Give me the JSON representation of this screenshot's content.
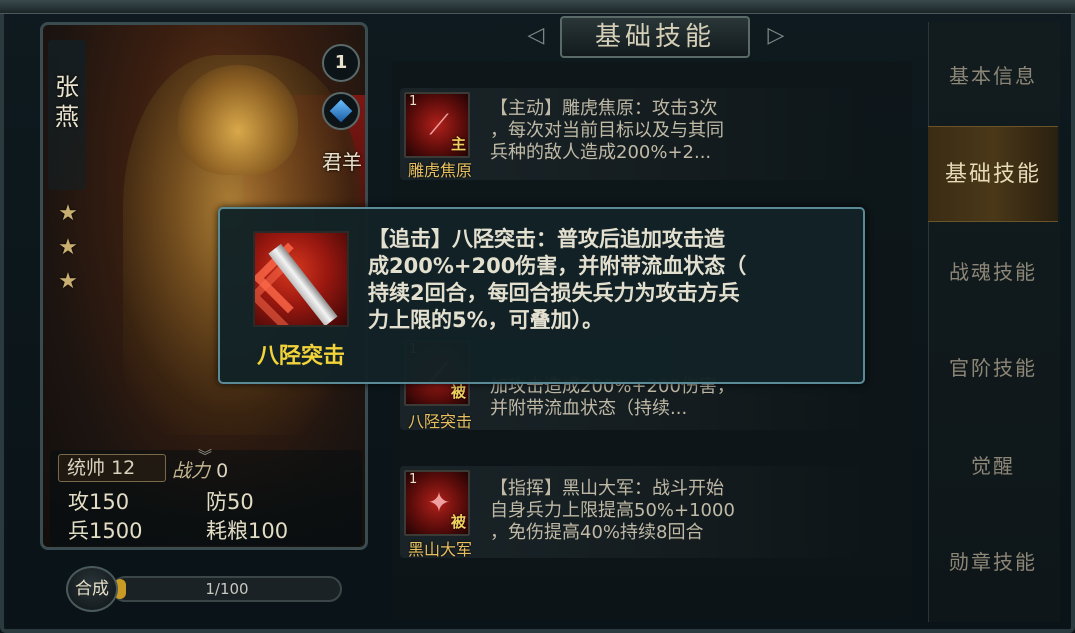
{
  "hero": {
    "name": "张燕",
    "level": "1",
    "faction": "君羊",
    "stars": 3,
    "command_label": "统帅",
    "command_value": "12",
    "power_label": "战力",
    "power_value": "0",
    "attack_label": "攻",
    "attack_value": "150",
    "defense_label": "防",
    "defense_value": "50",
    "troops_label": "兵",
    "troops_value": "1500",
    "food_label": "耗粮",
    "food_value": "100"
  },
  "synthesize": {
    "button_label": "合成",
    "progress_text": "1/100",
    "progress_fraction": 0.01
  },
  "panel_title": "基础技能",
  "skills": [
    {
      "level": "1",
      "tag": "主",
      "name": "雕虎焦原",
      "desc_lines": [
        "【主动】雕虎焦原：攻击3次",
        "，每次对当前目标以及与其同",
        "兵种的敌人造成200%+2..."
      ]
    },
    {
      "level": "1",
      "tag": "被",
      "name": "八陉突击",
      "desc_lines": [
        "加攻击造成200%+200伤害，",
        "并附带流血状态（持续..."
      ]
    },
    {
      "level": "1",
      "tag": "被",
      "name": "黑山大军",
      "desc_lines": [
        "【指挥】黑山大军：战斗开始",
        "自身兵力上限提高50%+1000",
        "，免伤提高40%持续8回合"
      ]
    }
  ],
  "tabs": [
    {
      "label": "基本信息",
      "active": false
    },
    {
      "label": "基础技能",
      "active": true
    },
    {
      "label": "战魂技能",
      "active": false
    },
    {
      "label": "官阶技能",
      "active": false
    },
    {
      "label": "觉醒",
      "active": false
    },
    {
      "label": "勋章技能",
      "active": false
    }
  ],
  "tooltip": {
    "name": "八陉突击",
    "lines": [
      "【追击】八陉突击：普攻后追加攻击造",
      "成200%+200伤害，并附带流血状态（",
      "持续2回合，每回合损失兵力为攻击方兵",
      "力上限的5%，可叠加）。"
    ]
  },
  "colors": {
    "accent_gold": "#f2d33a",
    "active_tab": "#4a3818",
    "tooltip_border": "#5a8a96",
    "progress_fill": "#c99a24"
  }
}
